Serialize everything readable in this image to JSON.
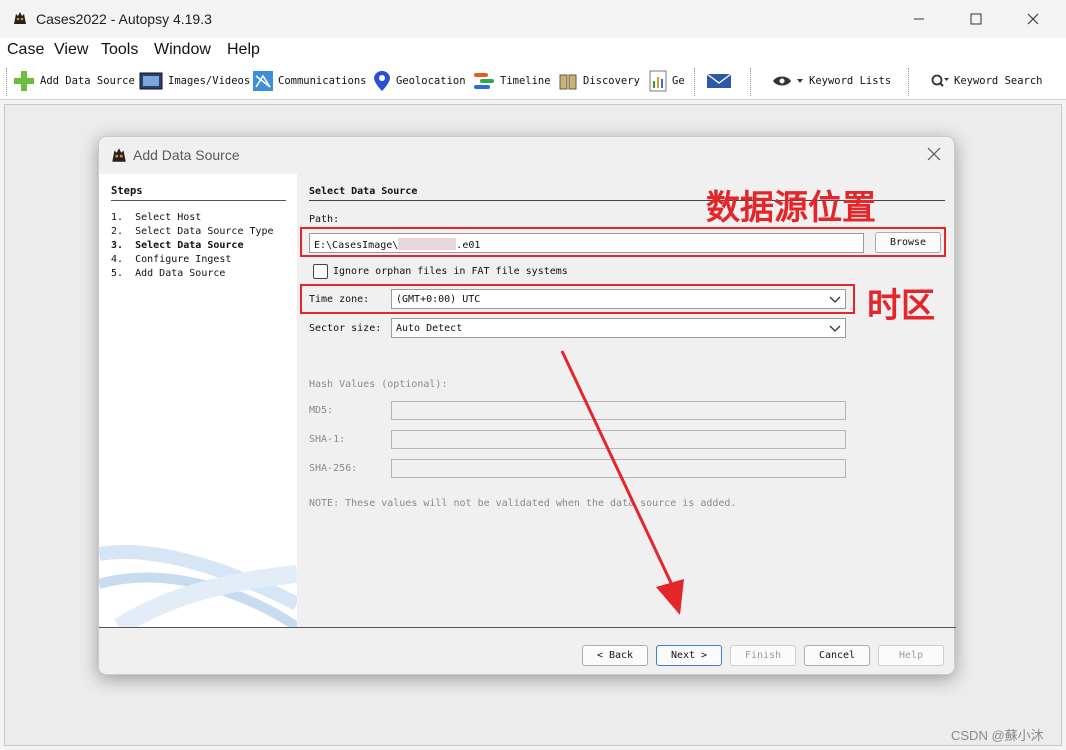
{
  "window": {
    "title": "Cases2022 - Autopsy 4.19.3",
    "controls": {
      "minimize": "minimize-icon",
      "maximize": "maximize-icon",
      "close": "close-icon"
    }
  },
  "menu": [
    "Case",
    "View",
    "Tools",
    "Window",
    "Help"
  ],
  "toolbar": {
    "add_data_source": "Add Data Source",
    "images_videos": "Images/Videos",
    "communications": "Communications",
    "geolocation": "Geolocation",
    "timeline": "Timeline",
    "discovery": "Discovery",
    "generate_report": "Ge",
    "keyword_lists": "Keyword Lists",
    "keyword_search": "Keyword Search"
  },
  "dialog": {
    "title": "Add Data Source",
    "steps_title": "Steps",
    "steps": [
      {
        "num": "1.",
        "label": "Select Host"
      },
      {
        "num": "2.",
        "label": "Select Data Source Type"
      },
      {
        "num": "3.",
        "label": "Select Data Source"
      },
      {
        "num": "4.",
        "label": "Configure Ingest"
      },
      {
        "num": "5.",
        "label": "Add Data Source"
      }
    ],
    "current_step": 3,
    "section_title": "Select Data Source",
    "path_label": "Path:",
    "path_prefix": "E:\\CasesImage\\",
    "path_suffix": ".e01",
    "browse": "Browse",
    "ignore_orphan": "Ignore orphan files in FAT file systems",
    "ignore_orphan_checked": false,
    "timezone_label": "Time zone:",
    "timezone_value": "(GMT+0:00) UTC",
    "sector_label": "Sector size:",
    "sector_value": "Auto Detect",
    "hash_title": "Hash Values (optional):",
    "md5_label": "MD5:",
    "sha1_label": "SHA-1:",
    "sha256_label": "SHA-256:",
    "note": "NOTE: These values will not be validated when the data source is added.",
    "buttons": {
      "back": "< Back",
      "next": "Next >",
      "finish": "Finish",
      "cancel": "Cancel",
      "help": "Help"
    }
  },
  "annotations": {
    "data_source_location": "数据源位置",
    "timezone": "时区",
    "color": "#e4262b"
  },
  "watermark": "CSDN @蘇小沐"
}
